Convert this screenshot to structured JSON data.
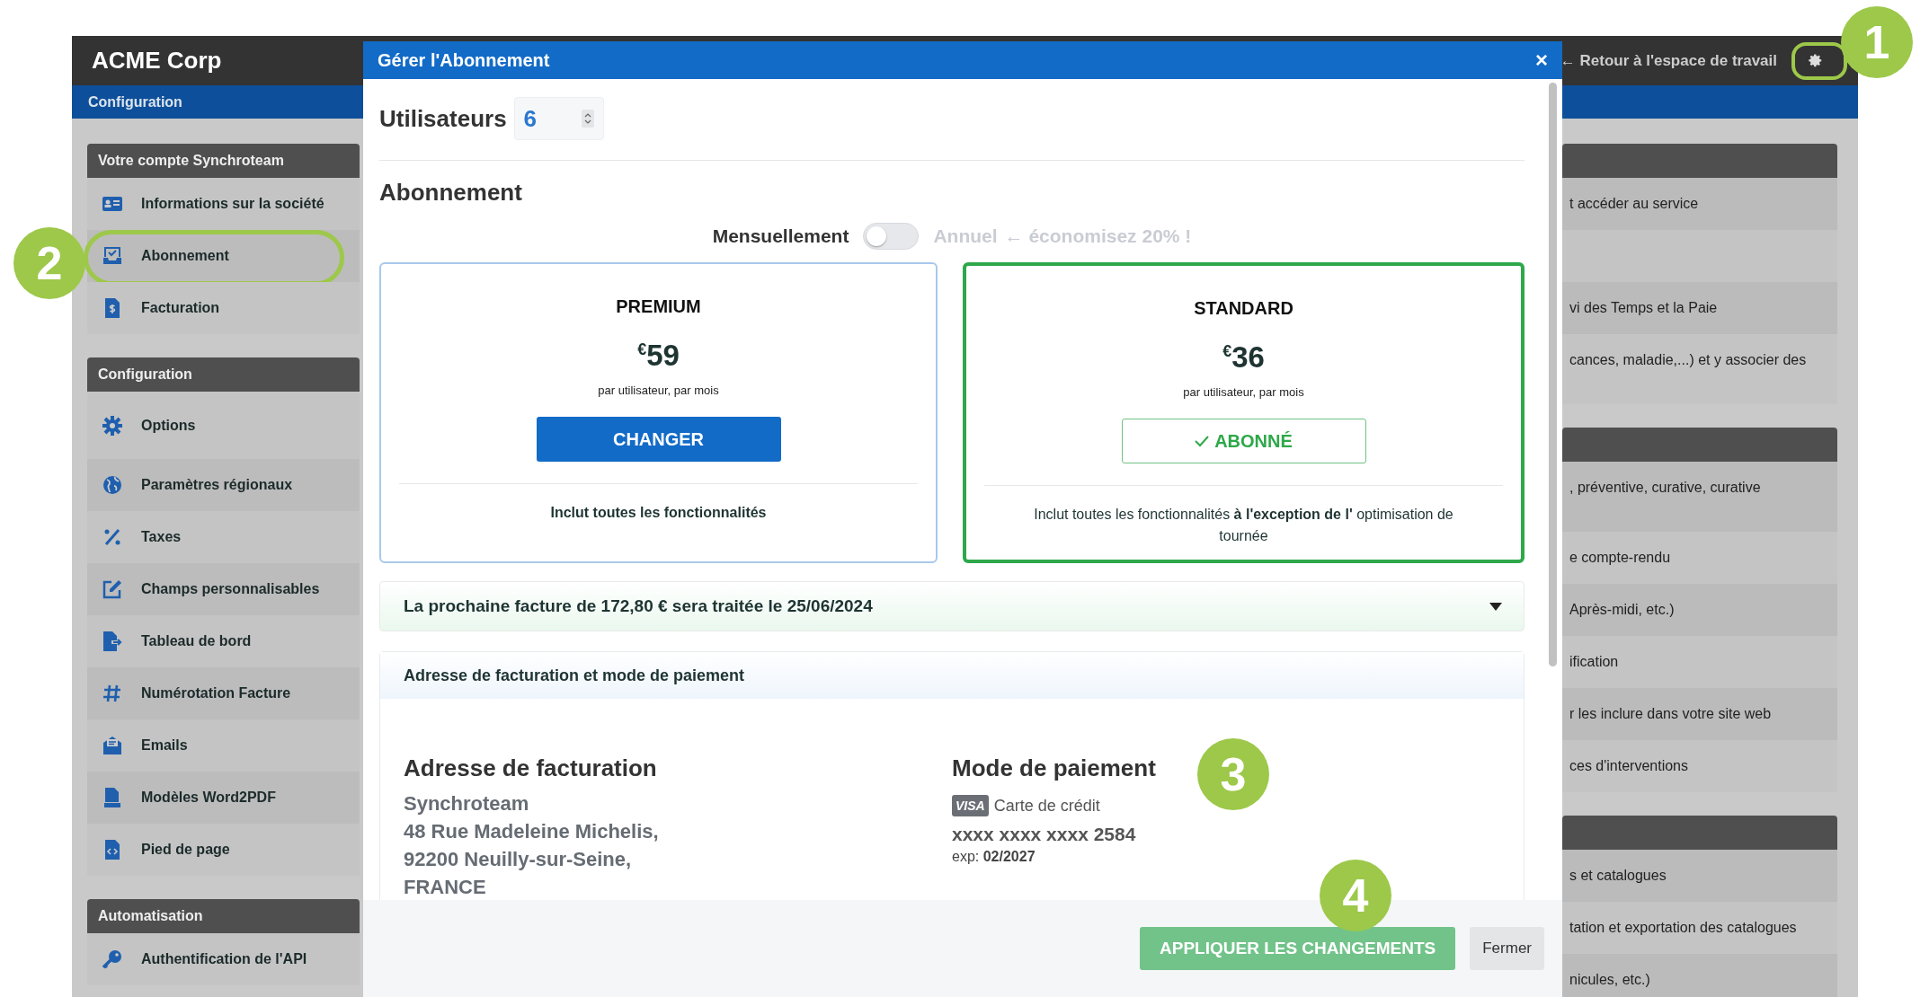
{
  "app": {
    "brand": "ACME Corp",
    "back_link": {
      "arrow": "←",
      "label": "Retour à l'espace de travail"
    },
    "settings": {
      "highlighted": true
    },
    "config_bar": "Configuration"
  },
  "sidebar": {
    "sections": [
      {
        "title": "Votre compte Synchroteam",
        "items": [
          {
            "label": "Informations sur la société",
            "highlighted": false
          },
          {
            "label": "Abonnement",
            "highlighted": true
          },
          {
            "label": "Facturation",
            "highlighted": false
          }
        ]
      },
      {
        "title": "Configuration",
        "items": [
          {
            "label": "Options",
            "highlighted": false
          },
          {
            "label": "Paramètres régionaux",
            "highlighted": false
          },
          {
            "label": "Taxes",
            "highlighted": false
          },
          {
            "label": "Champs personnalisables",
            "highlighted": false
          },
          {
            "label": "Tableau de bord",
            "highlighted": false
          },
          {
            "label": "Numérotation Facture",
            "highlighted": false
          },
          {
            "label": "Emails",
            "highlighted": false
          },
          {
            "label": "Modèles Word2PDF",
            "highlighted": false
          },
          {
            "label": "Pied de page",
            "highlighted": false
          }
        ]
      },
      {
        "title": "Automatisation",
        "items": [
          {
            "label": "Authentification de l'API",
            "highlighted": false
          }
        ]
      }
    ]
  },
  "right_panels": [
    {
      "rows": [
        {
          "text": "t accéder au service"
        },
        {},
        {
          "text": "vi des Temps et la Paie"
        },
        {
          "text": "cances, maladie,...) et y associer des"
        }
      ]
    },
    {
      "rows": [
        {
          "text": ", préventive, curative, curative"
        },
        {
          "text": "e compte-rendu"
        },
        {
          "text": "Après-midi, etc.)"
        },
        {
          "text": "ification"
        },
        {
          "text": "r les inclure dans votre site web"
        },
        {
          "text": "ces d'interventions"
        }
      ]
    },
    {
      "rows": [
        {
          "text": "s et catalogues"
        },
        {
          "text": "tation et exportation des catalogues"
        },
        {
          "text": "nicules, etc.)"
        }
      ]
    }
  ],
  "modal": {
    "title": "Gérer l'Abonnement",
    "close": "×",
    "users": {
      "label": "Utilisateurs",
      "value": "6"
    },
    "subscription_heading": "Abonnement",
    "billing": {
      "monthly": "Mensuellement",
      "annual": "Annuel",
      "savings": "← économisez 20% !",
      "on": false
    },
    "plans": [
      {
        "name": "PREMIUM",
        "currency": "€",
        "price": "59",
        "per": "par utilisateur, par mois",
        "selected": false,
        "button": {
          "kind": "change",
          "label": "CHANGER"
        },
        "features": {
          "text": "Inclut toutes les fonctionnalités",
          "bold": true
        }
      },
      {
        "name": "STANDARD",
        "currency": "€",
        "price": "36",
        "per": "par utilisateur, par mois",
        "selected": true,
        "button": {
          "kind": "subscribed",
          "label": "ABONNÉ"
        },
        "features": {
          "text": "Inclut toutes les fonctionnalités **à l'exception de l'** optimisation de tournée",
          "bold": false
        }
      }
    ],
    "invoice": {
      "text": "La prochaine facture de 172,80 € sera traitée le 25/06/2024"
    },
    "billing_section": {
      "title": "Adresse de facturation et mode de paiement",
      "address": {
        "heading": "Adresse de facturation",
        "lines": [
          "Synchroteam",
          "48 Rue Madeleine Michelis,",
          "92200 Neuilly-sur-Seine,",
          "FRANCE"
        ]
      },
      "payment": {
        "heading": "Mode de paiement",
        "card_brand": "VISA",
        "card_type": "Carte de crédit",
        "number": "xxxx xxxx xxxx 2584",
        "expiry_label": "exp:",
        "expiry": "02/2027"
      }
    },
    "footer_buttons": [
      {
        "kind": "primary",
        "label": "APPLIQUER LES CHANGEMENTS"
      },
      {
        "kind": "secondary",
        "label": "Fermer"
      }
    ]
  },
  "callouts": [
    {
      "label": "1"
    },
    {
      "label": "2"
    },
    {
      "label": "3"
    },
    {
      "label": "4"
    }
  ]
}
